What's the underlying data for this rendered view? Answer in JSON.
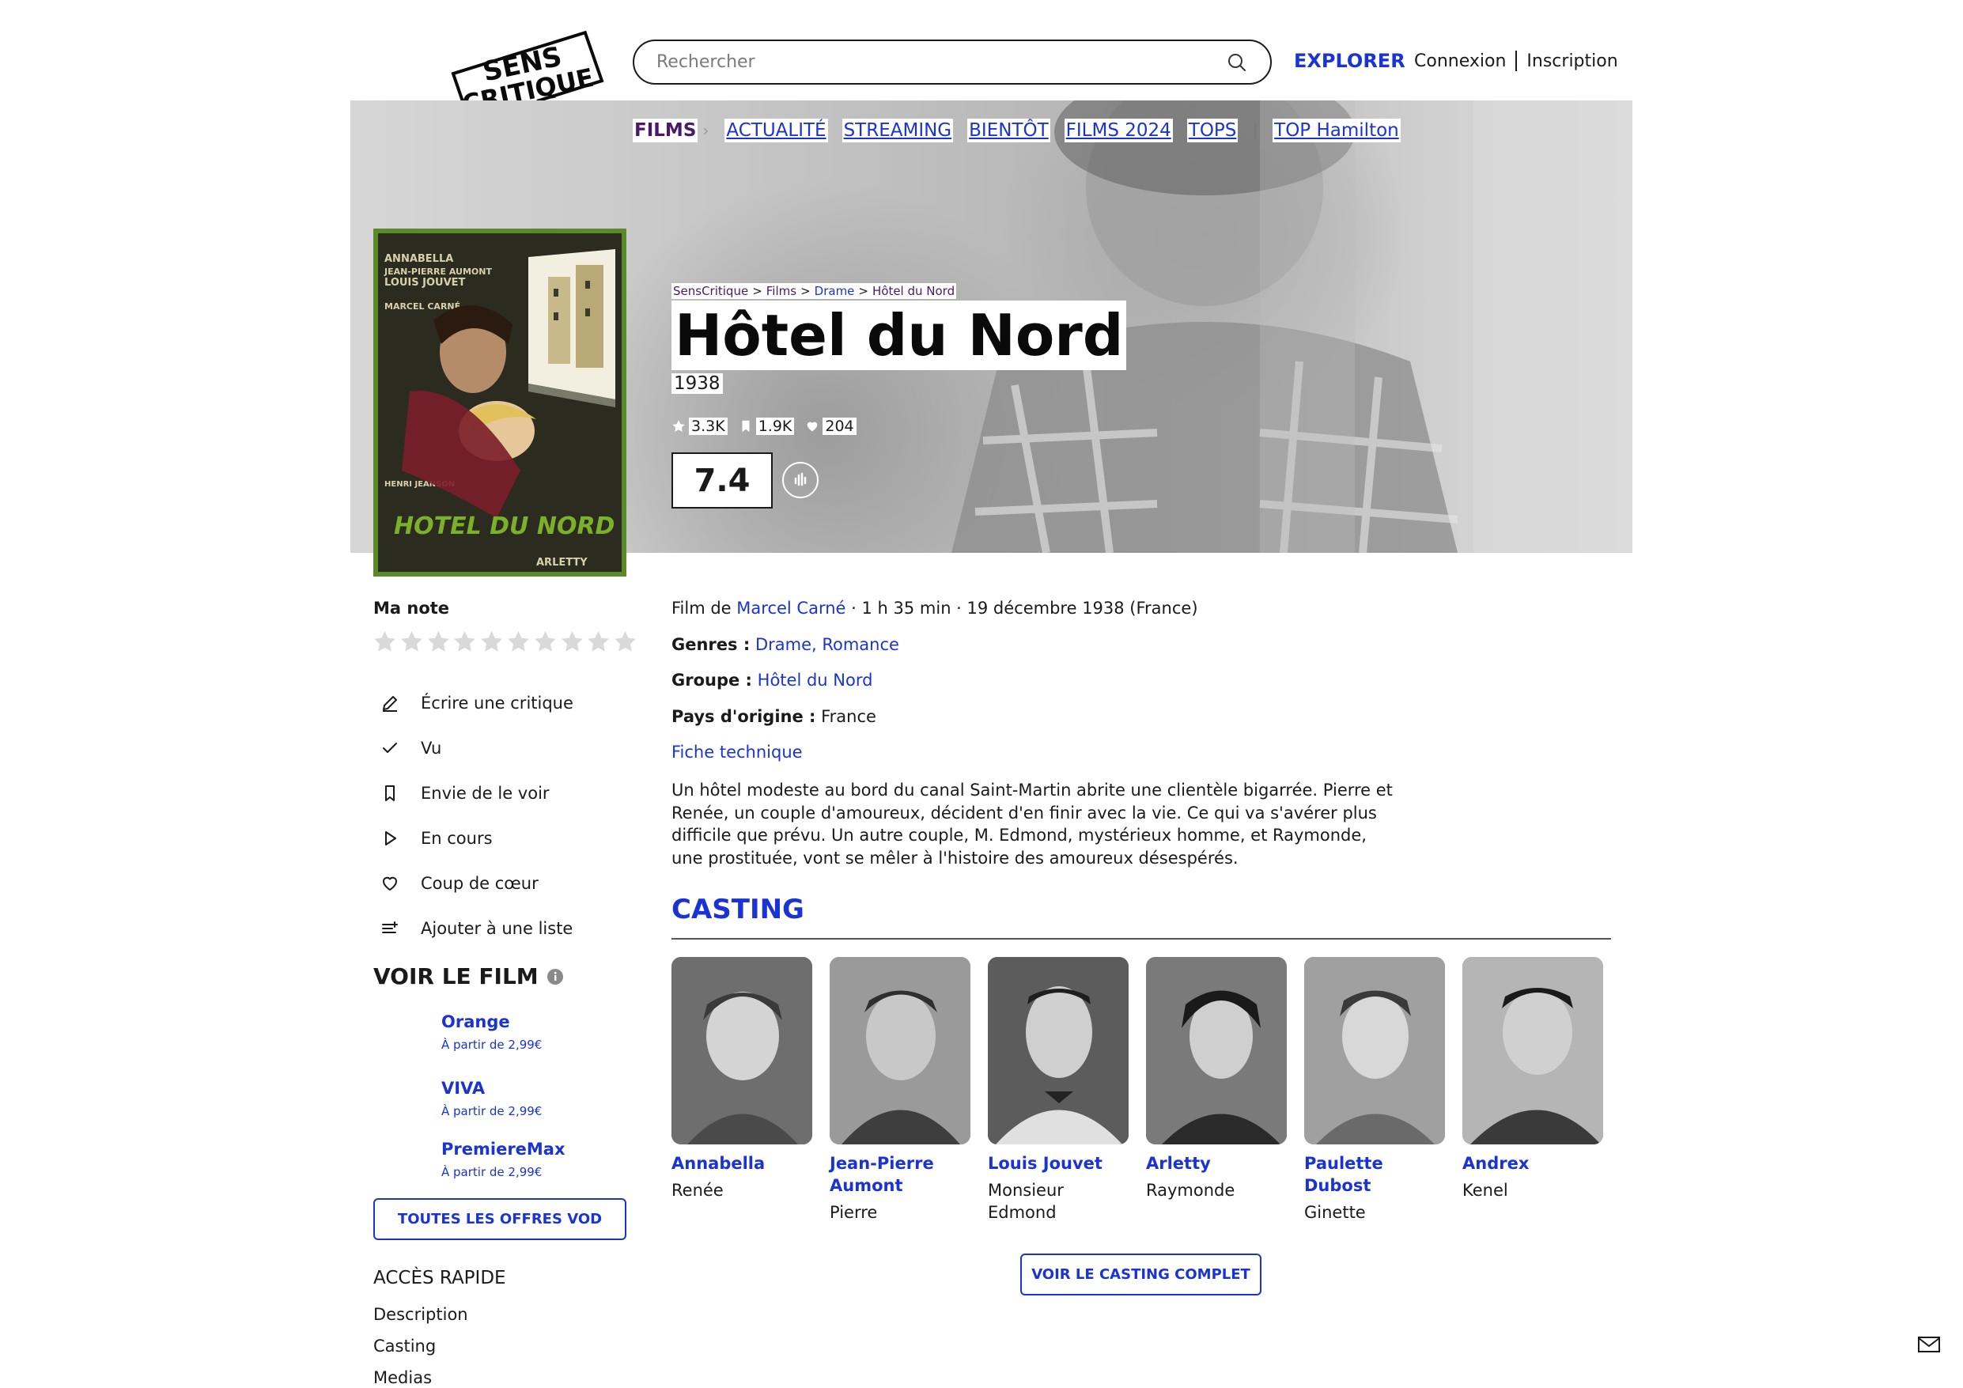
{
  "header": {
    "logo_text": "SENS CRITIQUE",
    "search_placeholder": "Rechercher",
    "explorer": "EXPLORER",
    "login": "Connexion",
    "signup": "Inscription"
  },
  "subnav": {
    "films": "FILMS",
    "items": [
      "ACTUALITÉ",
      "STREAMING",
      "BIENTÔT",
      "FILMS 2024",
      "TOPS"
    ],
    "top": "TOP Hamilton"
  },
  "breadcrumb": [
    "SensCritique",
    "Films",
    "Drame",
    "Hôtel du Nord"
  ],
  "movie": {
    "title": "Hôtel du Nord",
    "year": "1938",
    "stats": {
      "ratings": "3.3K",
      "wishlists": "1.9K",
      "favorites": "204"
    },
    "score": "7.4",
    "poster_credits": [
      "ANNABELLA",
      "JEAN-PIERRE AUMONT",
      "LOUIS JOUVET",
      "MARCEL CARNÉ",
      "HENRI JEANSON",
      "HOTEL DU NORD",
      "ARLETTY"
    ]
  },
  "sidebar": {
    "my_rating_label": "Ma note",
    "star_count": 10,
    "actions": [
      {
        "icon": "pencil-icon",
        "label": "Écrire une critique"
      },
      {
        "icon": "check-icon",
        "label": "Vu"
      },
      {
        "icon": "bookmark-icon",
        "label": "Envie de le voir"
      },
      {
        "icon": "play-icon",
        "label": "En cours"
      },
      {
        "icon": "heart-icon",
        "label": "Coup de cœur"
      },
      {
        "icon": "add-list-icon",
        "label": "Ajouter à une liste"
      }
    ],
    "watch_title": "VOIR LE FILM",
    "vod": [
      {
        "name": "Orange",
        "price": "À partir de 2,99€"
      },
      {
        "name": "VIVA",
        "price": "À partir de 2,99€"
      },
      {
        "name": "PremiereMax",
        "price": "À partir de 2,99€"
      }
    ],
    "vod_button": "TOUTES LES OFFRES VOD",
    "quick_access_title": "ACCÈS RAPIDE",
    "quick_access": [
      "Description",
      "Casting",
      "Medias"
    ]
  },
  "details": {
    "film_by_prefix": "Film de ",
    "director": "Marcel Carné",
    "meta": " · 1 h 35 min · 19 décembre 1938 (France)",
    "genres_label": "Genres :",
    "genre_1": "Drame",
    "genre_sep": ", ",
    "genre_2": "Romance",
    "group_label": "Groupe :",
    "group": "Hôtel du Nord",
    "country_label": "Pays d'origine :",
    "country": "France",
    "tech_sheet": "Fiche technique",
    "synopsis": "Un hôtel modeste au bord du canal Saint-Martin abrite une clientèle bigarrée. Pierre et Renée, un couple d'amoureux, décident d'en finir avec la vie. Ce qui va s'avérer plus difficile que prévu. Un autre couple, M. Edmond, mystérieux homme, et Raymonde, une prostituée, vont se mêler à l'histoire des amoureux désespérés."
  },
  "casting": {
    "title": "CASTING",
    "members": [
      {
        "actor": "Annabella",
        "role": "Renée"
      },
      {
        "actor": "Jean-Pierre Aumont",
        "role": "Pierre"
      },
      {
        "actor": "Louis Jouvet",
        "role": "Monsieur Edmond"
      },
      {
        "actor": "Arletty",
        "role": "Raymonde"
      },
      {
        "actor": "Paulette Dubost",
        "role": "Ginette"
      },
      {
        "actor": "Andrex",
        "role": "Kenel"
      }
    ],
    "button": "VOIR LE CASTING COMPLET"
  },
  "colors": {
    "accent": "#1a33d6",
    "films_nav": "#4a1a6a",
    "poster_frame": "#5b8a2a"
  }
}
